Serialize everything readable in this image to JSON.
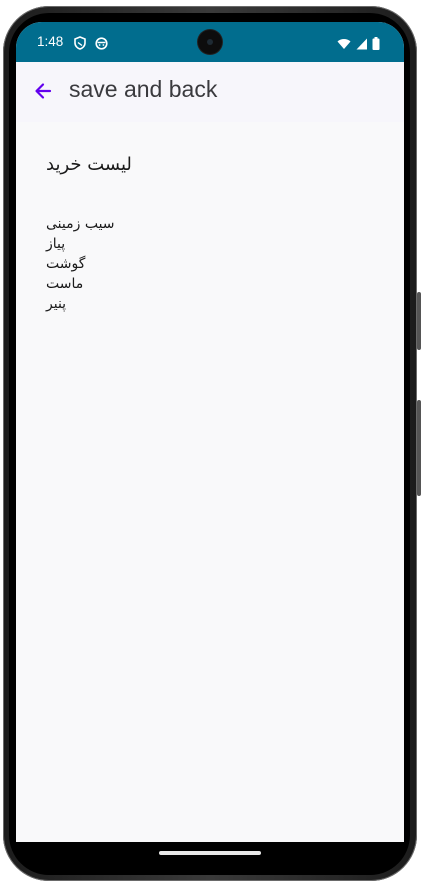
{
  "status_bar": {
    "time": "1:48",
    "left_icons": [
      "shield-icon",
      "face-icon"
    ],
    "right_icons": [
      "wifi-icon",
      "signal-icon",
      "battery-icon"
    ],
    "background_color": "#016d8e"
  },
  "app_bar": {
    "back_icon": "arrow-back-icon",
    "title": "save and back",
    "accent_color": "#6200ee"
  },
  "content": {
    "list_title": "لیست خرید",
    "items": [
      "سیب زمینی",
      "پیاز",
      "گوشت",
      "ماست",
      "پنیر"
    ]
  }
}
